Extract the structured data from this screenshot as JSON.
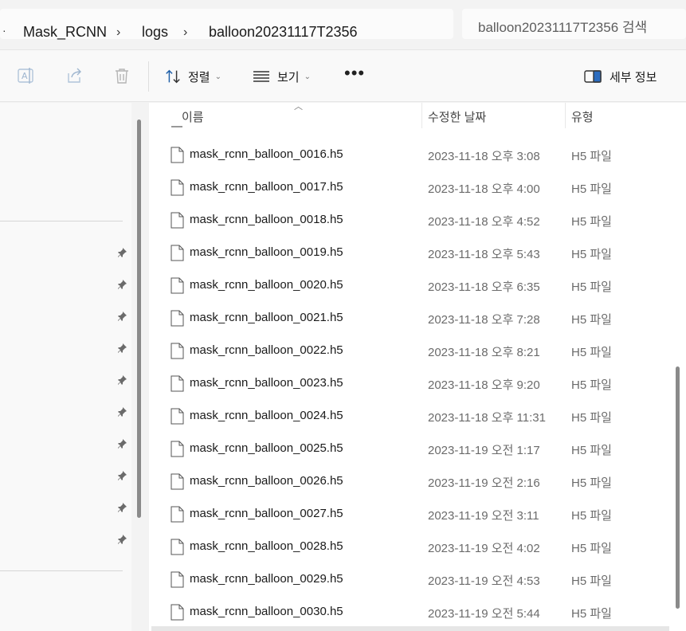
{
  "breadcrumb": {
    "overflow": "·",
    "items": [
      "Mask_RCNN",
      "logs",
      "balloon20231117T2356"
    ]
  },
  "search": {
    "placeholder": "balloon20231117T2356 검색"
  },
  "toolbar": {
    "sort_label": "정렬",
    "view_label": "보기",
    "more_label": "•••",
    "details_label": "세부 정보",
    "icons": [
      "rename-icon",
      "share-icon",
      "delete-icon",
      "sort-icon",
      "view-icon",
      "details-pane-icon"
    ]
  },
  "columns": {
    "name": "이름",
    "modified": "수정한 날짜",
    "type": "유형"
  },
  "files": [
    {
      "name": "mask_rcnn_balloon_0016.h5",
      "date": "2023-11-18 오후 3:08",
      "type": "H5 파일"
    },
    {
      "name": "mask_rcnn_balloon_0017.h5",
      "date": "2023-11-18 오후 4:00",
      "type": "H5 파일"
    },
    {
      "name": "mask_rcnn_balloon_0018.h5",
      "date": "2023-11-18 오후 4:52",
      "type": "H5 파일"
    },
    {
      "name": "mask_rcnn_balloon_0019.h5",
      "date": "2023-11-18 오후 5:43",
      "type": "H5 파일"
    },
    {
      "name": "mask_rcnn_balloon_0020.h5",
      "date": "2023-11-18 오후 6:35",
      "type": "H5 파일"
    },
    {
      "name": "mask_rcnn_balloon_0021.h5",
      "date": "2023-11-18 오후 7:28",
      "type": "H5 파일"
    },
    {
      "name": "mask_rcnn_balloon_0022.h5",
      "date": "2023-11-18 오후 8:21",
      "type": "H5 파일"
    },
    {
      "name": "mask_rcnn_balloon_0023.h5",
      "date": "2023-11-18 오후 9:20",
      "type": "H5 파일"
    },
    {
      "name": "mask_rcnn_balloon_0024.h5",
      "date": "2023-11-18 오후 11:31",
      "type": "H5 파일"
    },
    {
      "name": "mask_rcnn_balloon_0025.h5",
      "date": "2023-11-19 오전 1:17",
      "type": "H5 파일"
    },
    {
      "name": "mask_rcnn_balloon_0026.h5",
      "date": "2023-11-19 오전 2:16",
      "type": "H5 파일"
    },
    {
      "name": "mask_rcnn_balloon_0027.h5",
      "date": "2023-11-19 오전 3:11",
      "type": "H5 파일"
    },
    {
      "name": "mask_rcnn_balloon_0028.h5",
      "date": "2023-11-19 오전 4:02",
      "type": "H5 파일"
    },
    {
      "name": "mask_rcnn_balloon_0029.h5",
      "date": "2023-11-19 오전 4:53",
      "type": "H5 파일"
    },
    {
      "name": "mask_rcnn_balloon_0030.h5",
      "date": "2023-11-19 오전 5:44",
      "type": "H5 파일"
    }
  ],
  "nav": {
    "pinned_count": 10
  }
}
